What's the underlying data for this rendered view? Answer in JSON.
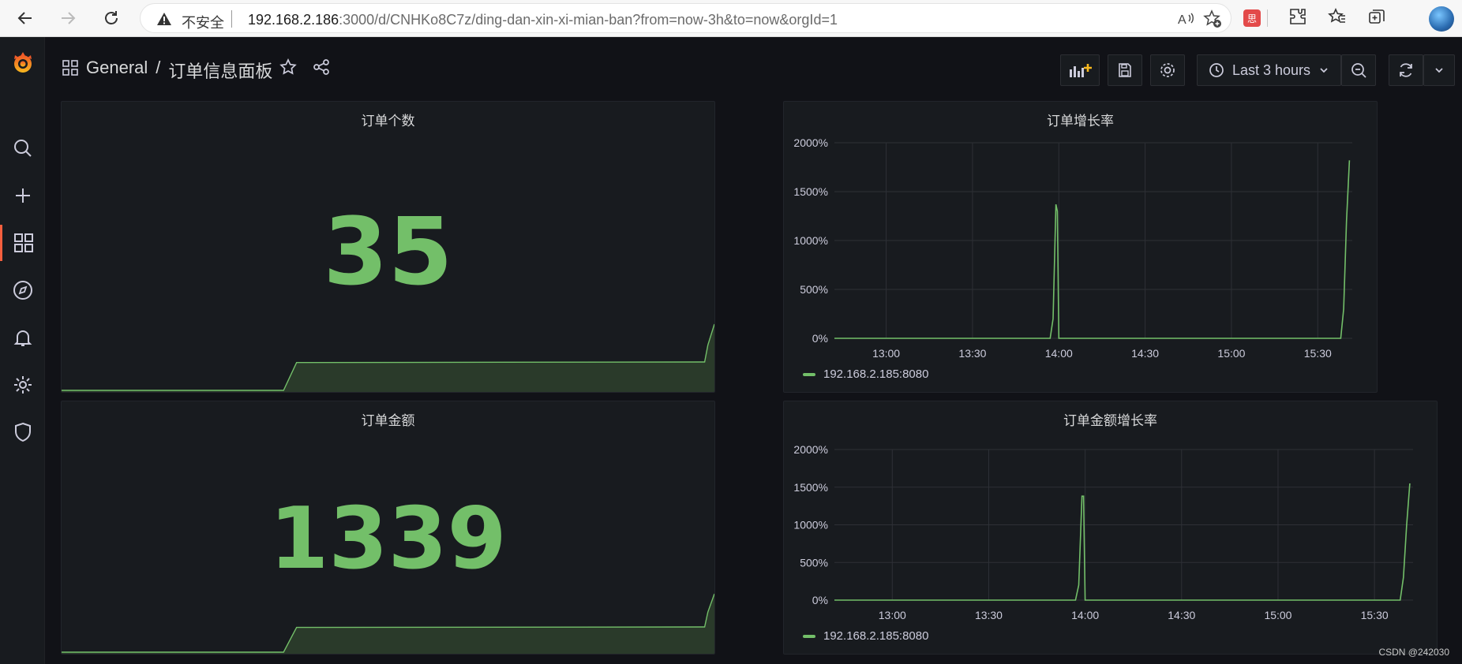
{
  "browser": {
    "insecure_label": "不安全",
    "url_host": "192.168.2.186",
    "url_rest": ":3000/d/CNHKo8C7z/ding-dan-xin-xi-mian-ban?from=now-3h&to=now&orgId=1",
    "ext_badge": "思"
  },
  "nav": {
    "folder": "General",
    "separator": "/",
    "dashboard_title": "订单信息面板",
    "time_range": "Last 3 hours"
  },
  "sidebar": {
    "items": [
      "grafana-logo",
      "search",
      "create",
      "dashboards",
      "explore",
      "alerting",
      "configuration",
      "server-admin"
    ],
    "active": "dashboards"
  },
  "colors": {
    "accent": "#73bf69",
    "spark_fill": "#2a3a2a",
    "grid": "#2e3036",
    "panel_bg": "#181b1f",
    "page_bg": "#111217",
    "active_marker": "#f55f3e"
  },
  "panels": {
    "order_count": {
      "title": "订单个数",
      "value": "35"
    },
    "order_amount": {
      "title": "订单金额",
      "value": "1339"
    },
    "order_growth": {
      "title": "订单增长率",
      "legend": "192.168.2.185:8080"
    },
    "amount_growth": {
      "title": "订单金额增长率",
      "legend": "192.168.2.185:8080"
    }
  },
  "chart_data": [
    {
      "type": "line",
      "title": "订单增长率",
      "x_ticks": [
        "13:00",
        "13:30",
        "14:00",
        "14:30",
        "15:00",
        "15:30"
      ],
      "y_ticks": [
        "0%",
        "500%",
        "1000%",
        "1500%",
        "2000%"
      ],
      "ylim": [
        0,
        2000
      ],
      "xlim": [
        "12:42",
        "15:42"
      ],
      "series": [
        {
          "name": "192.168.2.185:8080",
          "x": [
            "12:42",
            "13:57",
            "13:58",
            "13:59",
            "13:59:30",
            "14:00",
            "15:38",
            "15:39",
            "15:40",
            "15:41"
          ],
          "y": [
            0,
            0,
            200,
            1370,
            1300,
            0,
            0,
            300,
            1200,
            1820
          ]
        }
      ]
    },
    {
      "type": "line",
      "title": "订单金额增长率",
      "x_ticks": [
        "13:00",
        "13:30",
        "14:00",
        "14:30",
        "15:00",
        "15:30"
      ],
      "y_ticks": [
        "0%",
        "500%",
        "1000%",
        "1500%",
        "2000%"
      ],
      "ylim": [
        0,
        2000
      ],
      "xlim": [
        "12:42",
        "15:42"
      ],
      "series": [
        {
          "name": "192.168.2.185:8080",
          "x": [
            "12:42",
            "13:57",
            "13:58",
            "13:59",
            "13:59:30",
            "14:00",
            "15:38",
            "15:39",
            "15:40",
            "15:41"
          ],
          "y": [
            0,
            0,
            200,
            1380,
            1380,
            0,
            0,
            300,
            1000,
            1550
          ]
        }
      ]
    },
    {
      "type": "area",
      "title": "订单个数",
      "note": "stat sparkline",
      "ylim": [
        0,
        1
      ],
      "series": [
        {
          "x": [
            0,
            0.34,
            0.36,
            0.38,
            0.985,
            0.99,
            1.0
          ],
          "y": [
            0,
            0,
            0.98,
            0.98,
            1.0,
            1.0,
            1.0
          ]
        }
      ]
    },
    {
      "type": "area",
      "title": "订单金额",
      "note": "stat sparkline",
      "ylim": [
        0,
        1
      ],
      "series": [
        {
          "x": [
            0,
            0.34,
            0.36,
            0.38,
            0.985,
            0.99,
            1.0
          ],
          "y": [
            0,
            0,
            0.98,
            0.98,
            1.0,
            1.0,
            1.0
          ]
        }
      ]
    }
  ],
  "watermark": "CSDN @242030"
}
